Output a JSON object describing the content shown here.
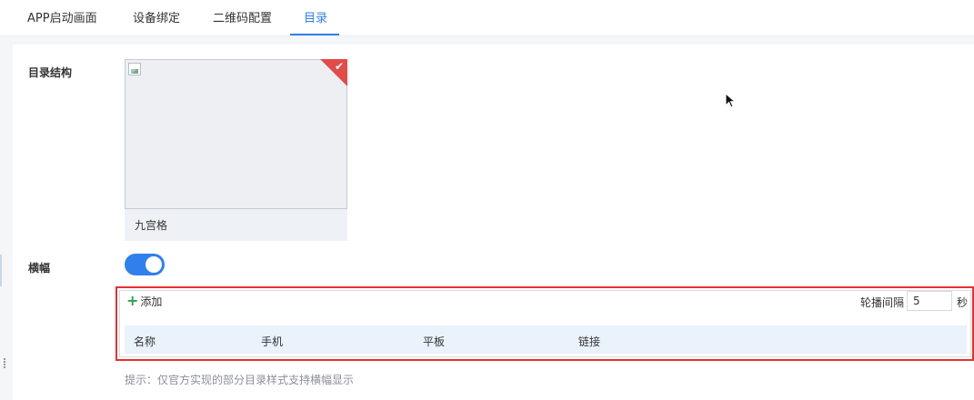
{
  "tabs": [
    {
      "label": "APP启动画面"
    },
    {
      "label": "设备绑定"
    },
    {
      "label": "二维码配置"
    },
    {
      "label": "目录"
    }
  ],
  "active_tab": "目录",
  "directory": {
    "label": "目录结构",
    "option_name": "九宫格",
    "selected_icon": "check-icon"
  },
  "banner": {
    "label": "横幅",
    "enabled": true,
    "add_label": "添加",
    "interval_label": "轮播间隔",
    "interval_value": "5",
    "interval_unit": "秒",
    "columns": [
      "名称",
      "手机",
      "平板",
      "链接"
    ],
    "hint": "提示：仅官方实现的部分目录样式支持横幅显示"
  },
  "colors": {
    "accent": "#2f80ed",
    "highlight": "#e5312f",
    "check_corner": "#e34a4a",
    "add_icon": "#2ba24c"
  }
}
